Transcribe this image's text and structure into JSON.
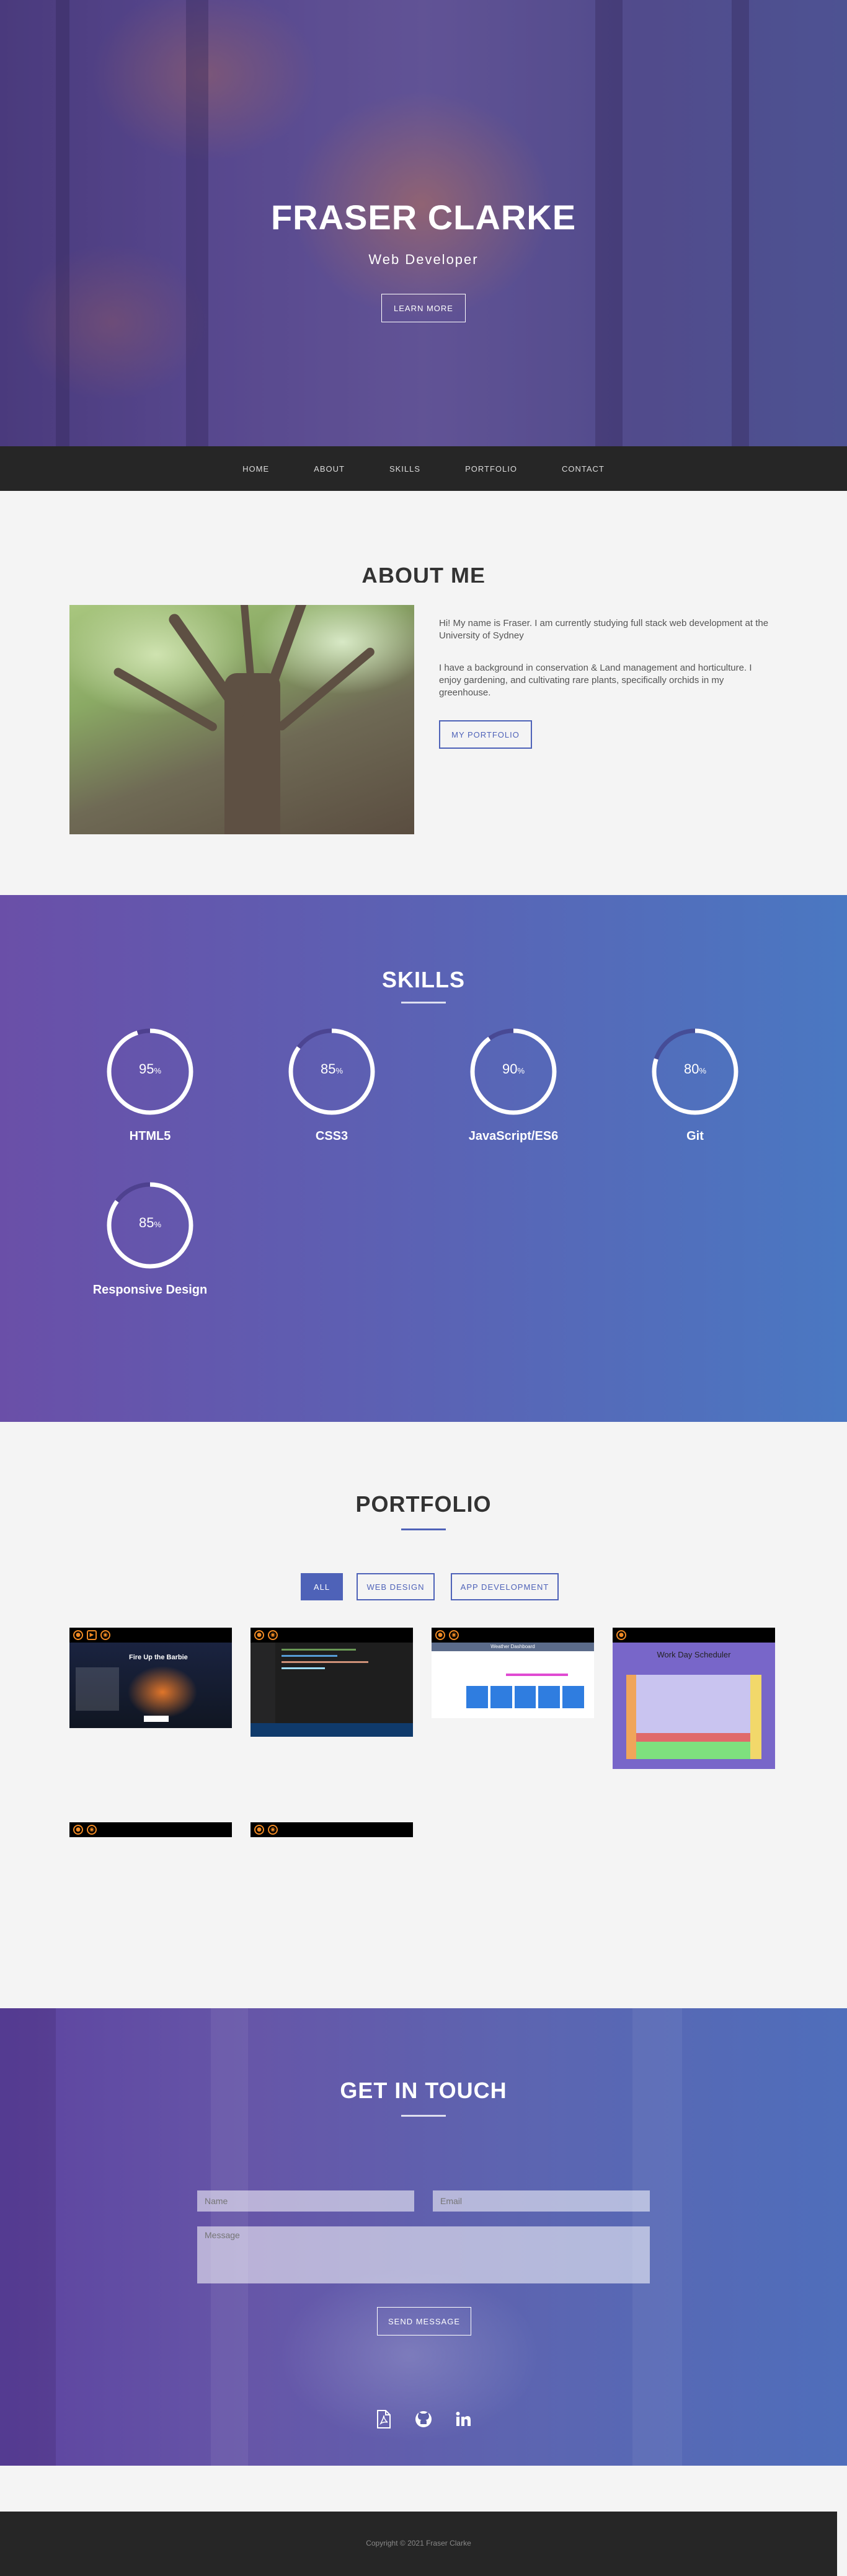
{
  "hero": {
    "title": "FRASER CLARKE",
    "subtitle": "Web Developer",
    "button": "LEARN MORE"
  },
  "nav": {
    "items": [
      "HOME",
      "ABOUT",
      "SKILLS",
      "PORTFOLIO",
      "CONTACT"
    ]
  },
  "about": {
    "title": "ABOUT ME",
    "paragraph1": "Hi! My name is Fraser. I am currently studying full stack web development at the University of Sydney",
    "paragraph2": "I have a background in conservation & Land management and horticulture. I enjoy gardening, and cultivating rare plants, specifically orchids in my greenhouse.",
    "button": "MY PORTFOLIO"
  },
  "skills": {
    "title": "SKILLS",
    "unit": "%",
    "items": [
      {
        "name": "HTML5",
        "value": 95
      },
      {
        "name": "CSS3",
        "value": 85
      },
      {
        "name": "JavaScript/ES6",
        "value": 90
      },
      {
        "name": "Git",
        "value": 80
      },
      {
        "name": "Responsive Design",
        "value": 85
      }
    ]
  },
  "portfolio": {
    "title": "PORTFOLIO",
    "filters": [
      "ALL",
      "WEB DESIGN",
      "APP DEVELOPMENT"
    ],
    "active_filter": "ALL",
    "projects": [
      {
        "icons": [
          "github-icon",
          "video-icon",
          "eye-icon"
        ],
        "screen_title": "Fire Up the Barbie"
      },
      {
        "icons": [
          "github-icon",
          "eye-icon"
        ],
        "screen_title": ""
      },
      {
        "icons": [
          "github-icon",
          "eye-icon"
        ],
        "screen_title": "Weather Dashboard"
      },
      {
        "icons": [
          "github-icon"
        ],
        "screen_title": "Work Day Scheduler"
      },
      {
        "icons": [
          "github-icon",
          "eye-icon"
        ],
        "screen_title": ""
      },
      {
        "icons": [
          "github-icon",
          "eye-icon"
        ],
        "screen_title": ""
      }
    ]
  },
  "contact": {
    "title": "GET IN TOUCH",
    "name_placeholder": "Name",
    "email_placeholder": "Email",
    "message_placeholder": "Message",
    "button": "SEND MESSAGE",
    "social": [
      "resume-pdf-icon",
      "github-icon",
      "linkedin-icon"
    ]
  },
  "footer": {
    "copyright": "Copyright © 2021 Fraser Clarke"
  },
  "colors": {
    "accent": "#4e62b8",
    "nav_bg": "#262626",
    "icon_orange": "#f08a24"
  }
}
